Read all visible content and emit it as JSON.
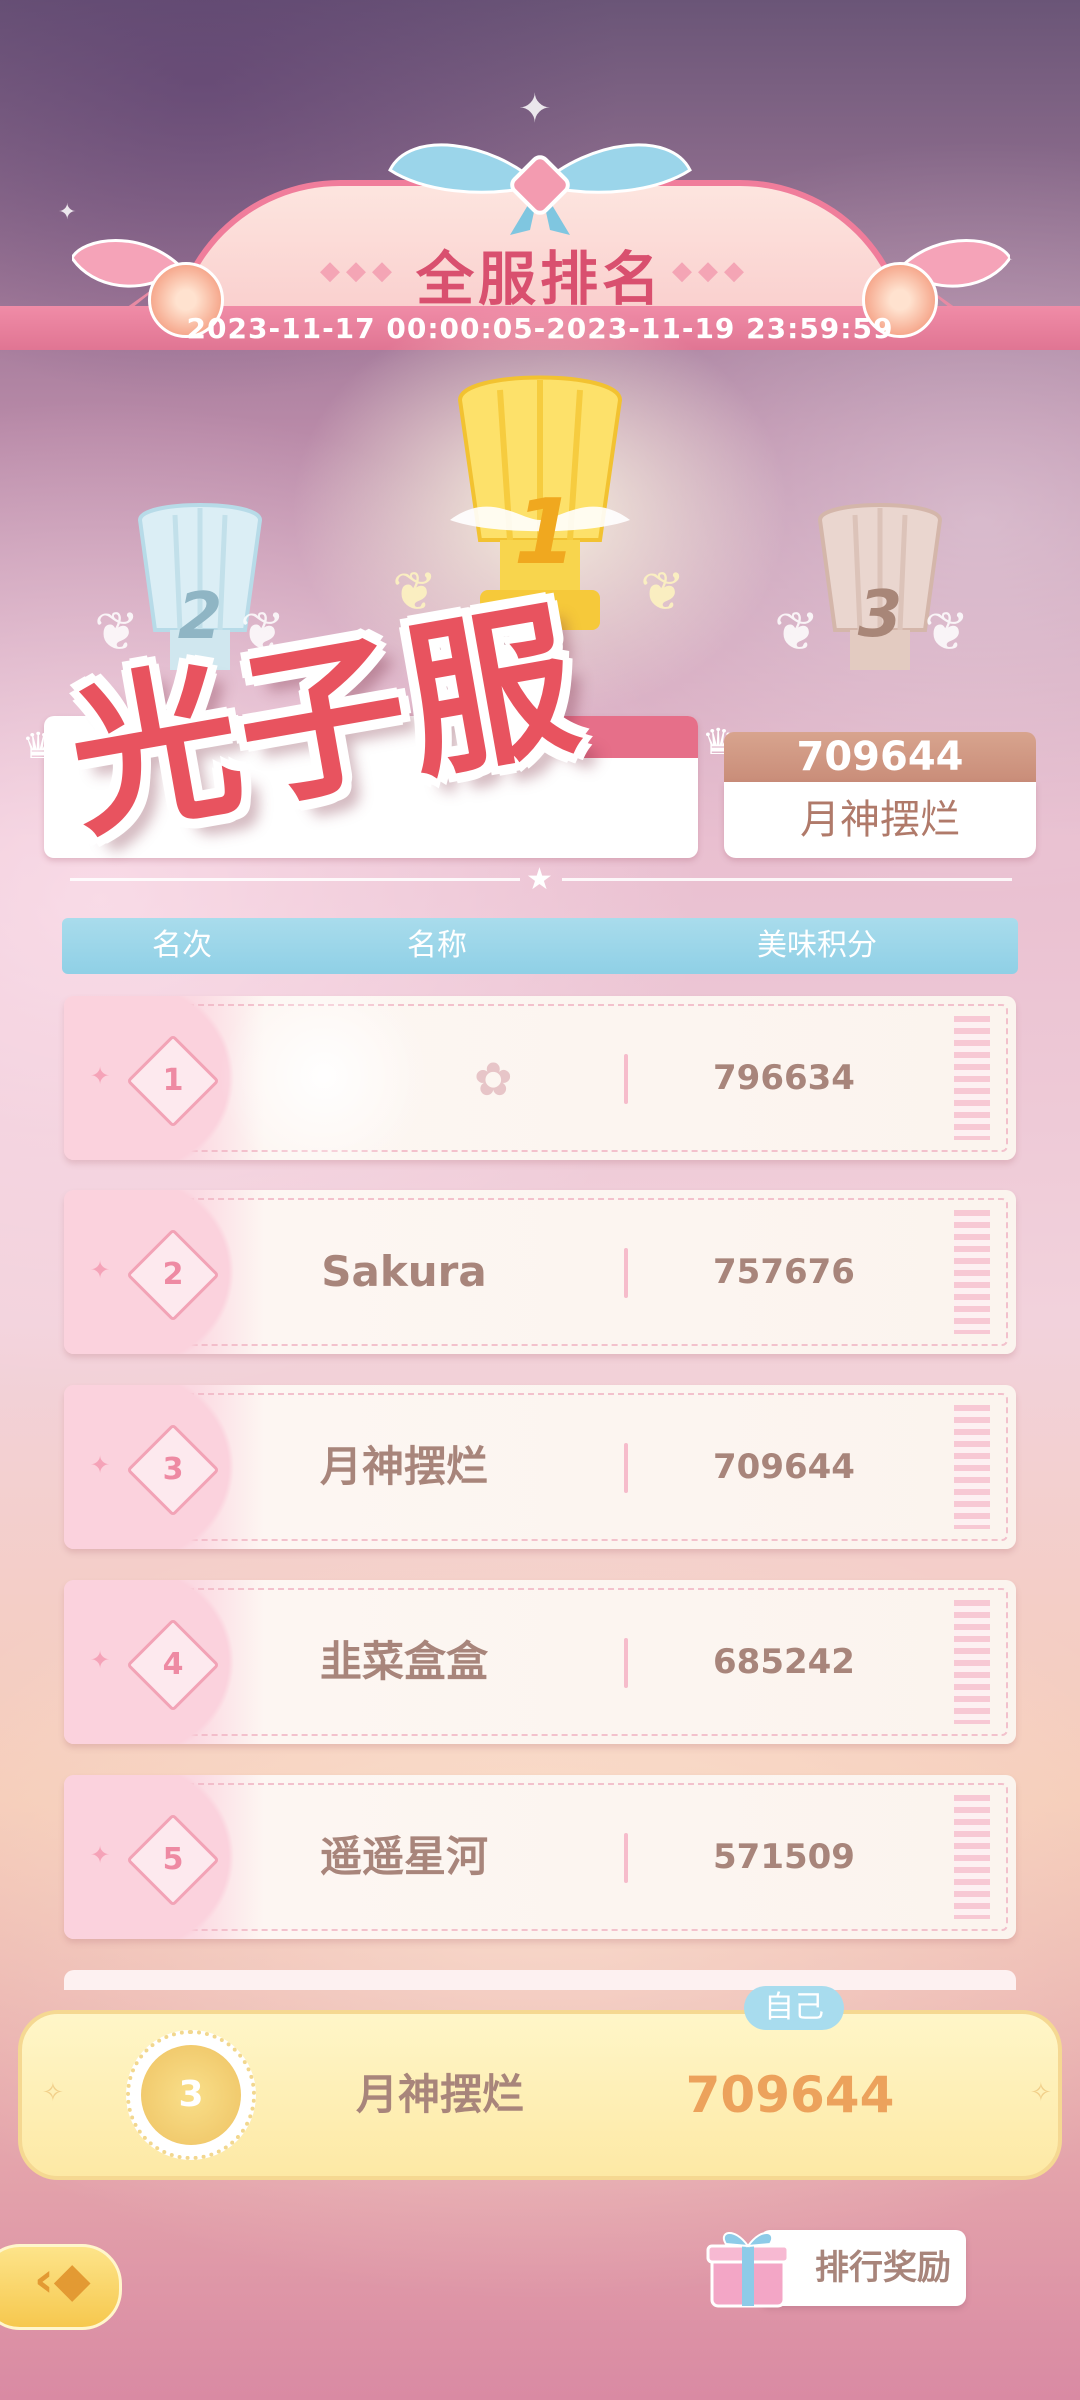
{
  "header": {
    "title": "全服排名",
    "date_range": "2023-11-17 00:00:05-2023-11-19 23:59:59"
  },
  "podium": {
    "first": {
      "rank_label": "1"
    },
    "second": {
      "rank_label": "2"
    },
    "third": {
      "rank_label": "3",
      "score": "709644",
      "name": "月神摆烂"
    }
  },
  "watermark": "光子服",
  "table": {
    "columns": [
      "名次",
      "名称",
      "美味积分"
    ],
    "rows": [
      {
        "rank": "1",
        "name": "",
        "score": "796634"
      },
      {
        "rank": "2",
        "name": "Sakura",
        "score": "757676"
      },
      {
        "rank": "3",
        "name": "月神摆烂",
        "score": "709644"
      },
      {
        "rank": "4",
        "name": "韭菜盒盒",
        "score": "685242"
      },
      {
        "rank": "5",
        "name": "遥遥星河",
        "score": "571509"
      }
    ]
  },
  "self": {
    "badge": "自己",
    "rank": "3",
    "name": "月神摆烂",
    "score": "709644"
  },
  "footer": {
    "reward_button": "排行奖励"
  },
  "icons": {
    "back": "back-arrow-icon",
    "gift": "gift-box-icon",
    "crown": "crown-icon"
  },
  "colors": {
    "accent_pink": "#e07593",
    "header_blue": "#a9dcec",
    "self_score": "#eca25c",
    "watermark_red": "#e8535f"
  }
}
